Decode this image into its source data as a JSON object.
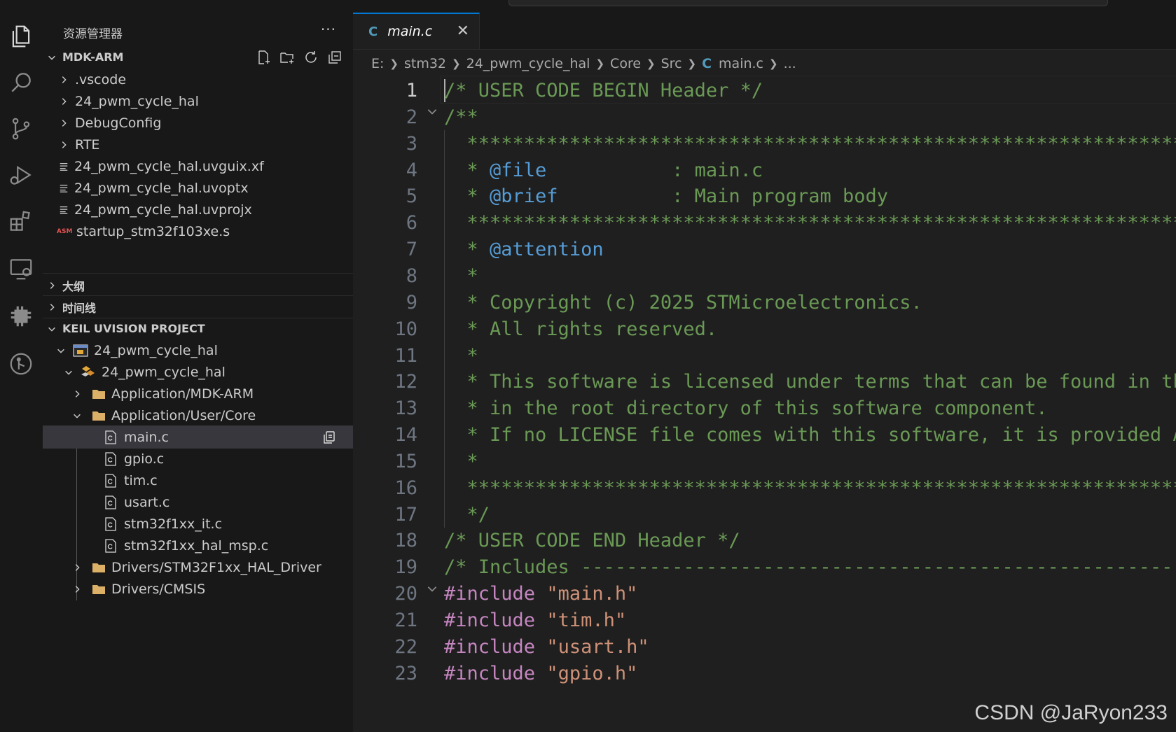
{
  "sidebar": {
    "title": "资源管理器",
    "more": "···",
    "workspace": "MDK-ARM",
    "folders": [
      ".vscode",
      "24_pwm_cycle_hal",
      "DebugConfig",
      "RTE"
    ],
    "files": [
      "24_pwm_cycle_hal.uvguix.xf",
      "24_pwm_cycle_hal.uvoptx",
      "24_pwm_cycle_hal.uvprojx",
      "startup_stm32f103xe.s"
    ],
    "asm_badge": "ASM",
    "outline": "大纲",
    "timeline": "时间线",
    "keil": {
      "title": "KEIL UVISION PROJECT",
      "project": "24_pwm_cycle_hal",
      "target": "24_pwm_cycle_hal",
      "groups": [
        "Application/MDK-ARM",
        "Application/User/Core",
        "Drivers/STM32F1xx_HAL_Driver",
        "Drivers/CMSIS"
      ],
      "core_files": [
        "main.c",
        "gpio.c",
        "tim.c",
        "usart.c",
        "stm32f1xx_it.c",
        "stm32f1xx_hal_msp.c"
      ]
    }
  },
  "editor": {
    "tab": {
      "icon": "C",
      "name": "main.c",
      "close": "✕"
    },
    "breadcrumbs": [
      "E:",
      "stm32",
      "24_pwm_cycle_hal",
      "Core",
      "Src"
    ],
    "breadcrumb_file": "main.c",
    "breadcrumb_more": "...",
    "lines": [
      "/* USER CODE BEGIN Header */",
      "/**",
      "  ******************************************************************************",
      "  * ",
      "  * ",
      "  ******************************************************************************",
      "  * ",
      "  *",
      "  * Copyright (c) 2025 STMicroelectronics.",
      "  * All rights reserved.",
      "  *",
      "  * This software is licensed under terms that can be found in the LICENSE file",
      "  * in the root directory of this software component.",
      "  * If no LICENSE file comes with this software, it is provided AS-IS.",
      "  *",
      "  ******************************************************************************",
      "  */",
      "/* USER CODE END Header */",
      "/* Includes ------------------------------------------------------------------*/"
    ],
    "doc_tags": {
      "file_tag": "@file",
      "file_rest": "           : main.c",
      "brief_tag": "@brief",
      "brief_rest": "          : Main program body",
      "attention_tag": "@attention"
    },
    "includes": [
      {
        "kw": "#include",
        "str": "\"main.h\""
      },
      {
        "kw": "#include",
        "str": "\"tim.h\""
      },
      {
        "kw": "#include",
        "str": "\"usart.h\""
      },
      {
        "kw": "#include",
        "str": "\"gpio.h\""
      }
    ],
    "line_numbers": [
      "1",
      "2",
      "3",
      "4",
      "5",
      "6",
      "7",
      "8",
      "9",
      "10",
      "11",
      "12",
      "13",
      "14",
      "15",
      "16",
      "17",
      "18",
      "19",
      "20",
      "21",
      "22",
      "23"
    ]
  },
  "watermark": "CSDN @JaRyon233",
  "colors": {
    "accent": "#0078d4",
    "comment": "#6a9955",
    "keyword": "#c586c0",
    "string": "#ce9178",
    "doc_tag": "#569cd6"
  }
}
